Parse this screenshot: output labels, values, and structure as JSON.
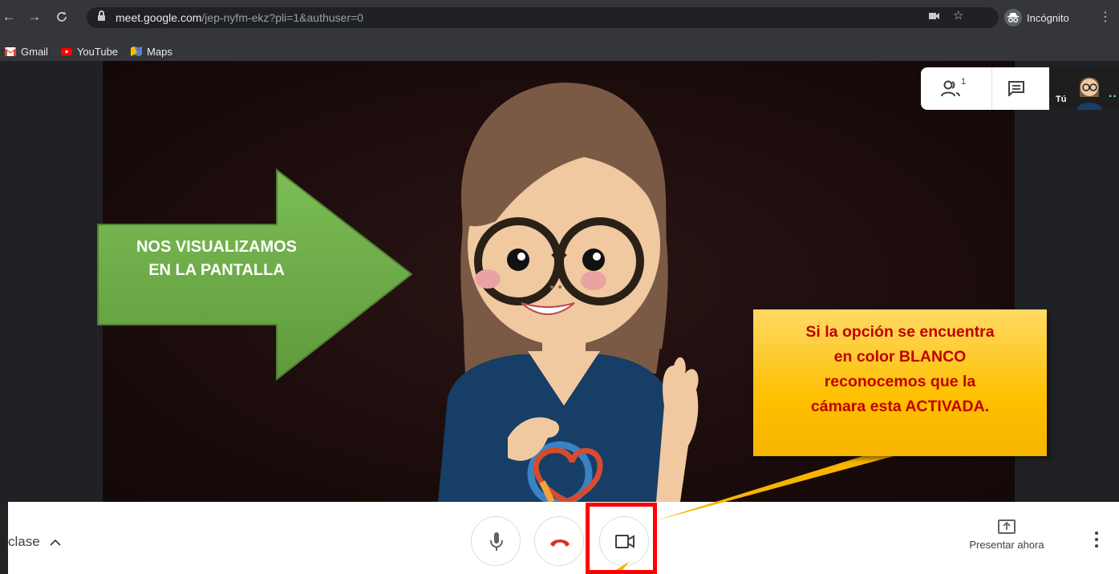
{
  "browser": {
    "url_host": "meet.google.com",
    "url_path": "/jep-nyfm-ekz?pli=1&authuser=0",
    "profile_label": "Incógnito",
    "nav_icons": [
      "back-arrow-icon",
      "forward-arrow-icon",
      "reload-icon"
    ],
    "bookmarks": [
      {
        "label": "Gmail",
        "icon": "gmail-icon",
        "color": "#ea4335"
      },
      {
        "label": "YouTube",
        "icon": "youtube-icon",
        "color": "#ff0000"
      },
      {
        "label": "Maps",
        "icon": "maps-icon",
        "color": "#34a853"
      }
    ]
  },
  "meet": {
    "participants_badge": "1",
    "self_label": "Tú",
    "meeting_name": "clase",
    "present_label": "Presentar ahora",
    "controls": [
      "microphone-icon",
      "hang-up-icon",
      "camera-icon"
    ],
    "hangup_color": "#d93025"
  },
  "annotations": {
    "arrow_line1": "NOS VISUALIZAMOS",
    "arrow_line2": "EN LA PANTALLA",
    "arrow_color": "#70ad47",
    "callout_line1": "Si la opción se encuentra",
    "callout_line2": "en color BLANCO",
    "callout_line3": "reconocemos que la",
    "callout_line4": "cámara esta ACTIVADA.",
    "callout_text_color": "#c00000",
    "highlight_color": "#ff0000"
  }
}
